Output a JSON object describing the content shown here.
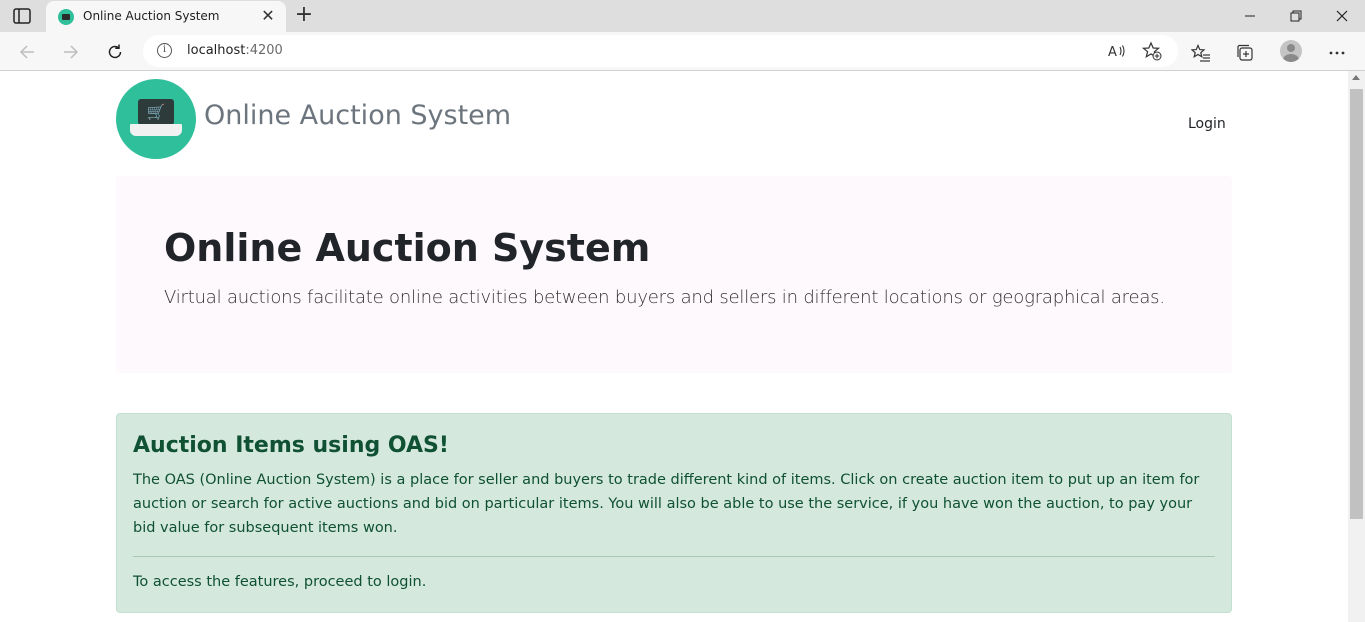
{
  "browser": {
    "tab_title": "Online Auction System",
    "url_host": "localhost",
    "url_port": ":4200",
    "icons": {
      "sidebar": "sidebar-icon",
      "new_tab": "plus-icon",
      "back": "arrow-left-icon",
      "forward": "arrow-right-icon",
      "refresh": "refresh-icon",
      "site_info": "info-icon",
      "read_aloud": "read-aloud-icon",
      "add_favorite": "star-plus-icon",
      "favorites": "favorites-icon",
      "collections": "collections-icon",
      "profile": "profile-icon",
      "more": "ellipsis-icon"
    }
  },
  "header": {
    "brand": "Online Auction System",
    "login": "Login",
    "logo_icon": "laptop-cart-icon"
  },
  "hero": {
    "title": "Online Auction System",
    "lead": "Virtual auctions facilitate online activities between buyers and sellers in different locations or geographical areas."
  },
  "info": {
    "heading": "Auction Items using OAS!",
    "body": "The OAS (Online Auction System) is a place for seller and buyers to trade different kind of items. Click on create auction item to put up an item for auction or search for active auctions and bid on particular items. You will also be able to use the service, if you have won the auction, to pay your bid value for subsequent items won.",
    "footer": "To access the features, proceed to login."
  },
  "colors": {
    "brand_teal": "#2fbf9a",
    "alert_bg": "#d4e8dd",
    "alert_text": "#0f5132",
    "hero_bg": "#fdf9fd"
  }
}
